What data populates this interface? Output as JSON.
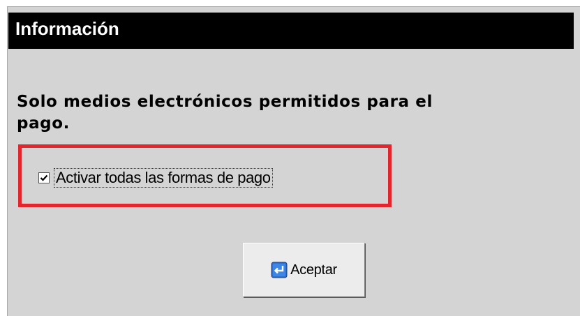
{
  "dialog": {
    "title": "Información",
    "message": "Solo medios electrónicos permitidos para el pago.",
    "checkbox": {
      "label": "Activar todas las formas de pago",
      "checked": true
    },
    "ok_button": {
      "label": "Aceptar",
      "icon": "enter-icon"
    }
  },
  "colors": {
    "titlebar_bg": "#000000",
    "dialog_bg": "#d4d4d4",
    "highlight_border": "#e3252d",
    "icon_blue": "#2f6fd0"
  }
}
